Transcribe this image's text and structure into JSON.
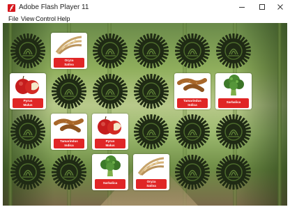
{
  "window": {
    "title": "Adobe Flash Player 11",
    "minimize_icon": "minimize-icon",
    "maximize_icon": "maximize-icon",
    "close_icon": "close-icon"
  },
  "menu": [
    "File",
    "View",
    "Control",
    "Help"
  ],
  "colors": {
    "label_red": "#e02626",
    "card_back": "#1f2a14"
  },
  "cards": [
    {
      "state": "back"
    },
    {
      "state": "front",
      "icon": "rice-icon",
      "label": "Oryza\nSativa"
    },
    {
      "state": "back"
    },
    {
      "state": "back"
    },
    {
      "state": "back"
    },
    {
      "state": "back"
    },
    {
      "state": "front",
      "icon": "apple-icon",
      "label": "Pyrus\nMalus"
    },
    {
      "state": "back"
    },
    {
      "state": "back"
    },
    {
      "state": "back"
    },
    {
      "state": "front",
      "icon": "tamarind-icon",
      "label": "Tamarindus\nIndica"
    },
    {
      "state": "front",
      "icon": "broccoli-icon",
      "label": "Sarbalica"
    },
    {
      "state": "back"
    },
    {
      "state": "front",
      "icon": "tamarind-icon",
      "label": "Tamarindus\nIndica"
    },
    {
      "state": "front",
      "icon": "apple-icon",
      "label": "Pyrus\nMalus"
    },
    {
      "state": "back"
    },
    {
      "state": "back"
    },
    {
      "state": "back"
    },
    {
      "state": "back"
    },
    {
      "state": "back"
    },
    {
      "state": "front",
      "icon": "broccoli-icon",
      "label": "Sarbalica"
    },
    {
      "state": "front",
      "icon": "rice-icon",
      "label": "Oryza\nSativa"
    },
    {
      "state": "back"
    },
    {
      "state": "back"
    }
  ]
}
